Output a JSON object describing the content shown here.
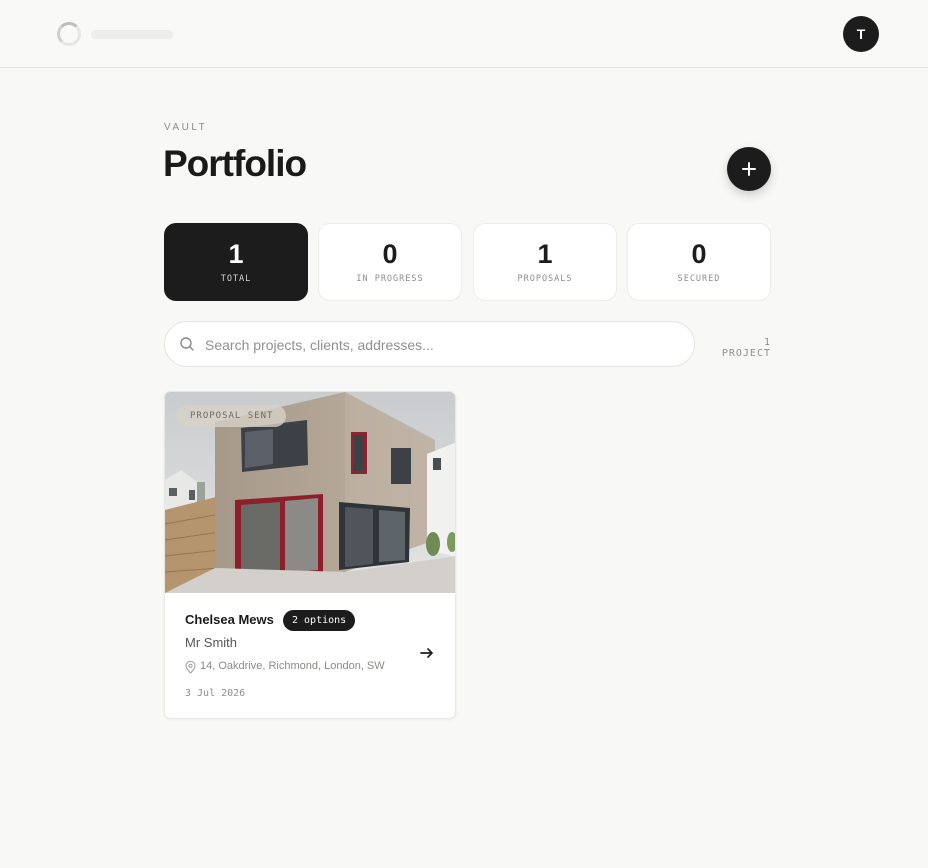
{
  "header": {
    "avatar_initial": "T"
  },
  "page": {
    "eyebrow": "VAULT",
    "title": "Portfolio"
  },
  "stats": [
    {
      "value": "1",
      "label": "TOTAL",
      "active": true
    },
    {
      "value": "0",
      "label": "IN PROGRESS",
      "active": false
    },
    {
      "value": "1",
      "label": "PROPOSALS",
      "active": false
    },
    {
      "value": "0",
      "label": "SECURED",
      "active": false
    }
  ],
  "search": {
    "placeholder": "Search projects, clients, addresses...",
    "value": ""
  },
  "project_count": "1 PROJECT",
  "projects": [
    {
      "status": "PROPOSAL SENT",
      "name": "Chelsea Mews",
      "options": "2 options",
      "client": "Mr Smith",
      "address": "14, Oakdrive, Richmond, London, SW",
      "date": "3 Jul 2026",
      "image": "house-photo"
    }
  ],
  "icons": {
    "add": "plus-icon",
    "search": "search-icon",
    "pin": "map-pin-icon",
    "open": "arrow-right-icon",
    "loading": "spinner-icon"
  },
  "colors": {
    "background": "#f8f8f6",
    "dark": "#1c1c1c",
    "muted": "#8e8e8b",
    "card": "#ffffff"
  }
}
